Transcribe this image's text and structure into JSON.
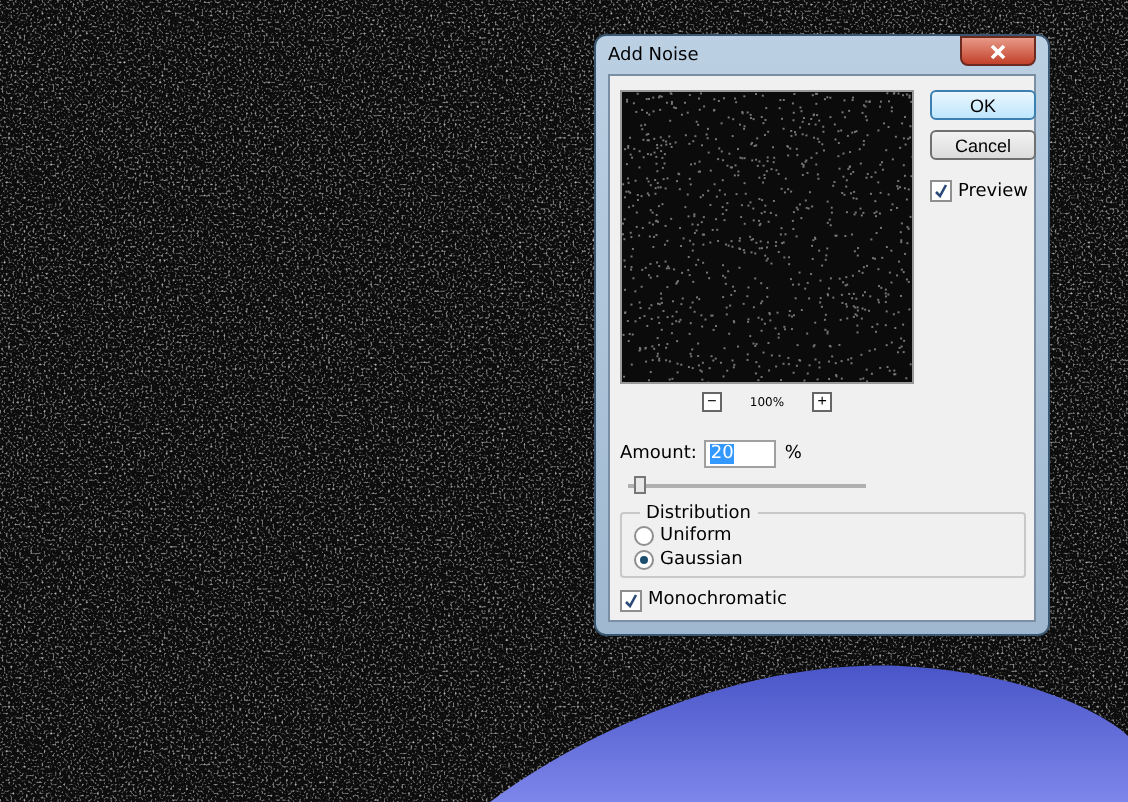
{
  "window": {
    "title": "Add Noise"
  },
  "buttons": [
    {
      "label": "OK",
      "default": true
    },
    {
      "label": "Cancel",
      "default": false
    }
  ],
  "preview": {
    "label": "Preview",
    "checked": true
  },
  "zoom": {
    "minus": "−",
    "value": "100%",
    "plus": "+"
  },
  "amount": {
    "label": "Amount:",
    "value": "20",
    "unit": "%",
    "level": 0.05
  },
  "distribution": {
    "title": "Distribution",
    "options": [
      {
        "label": "Uniform",
        "selected": false
      },
      {
        "label": "Gaussian",
        "selected": true
      }
    ]
  },
  "monochromatic": {
    "label": "Monochromatic",
    "checked": true
  }
}
